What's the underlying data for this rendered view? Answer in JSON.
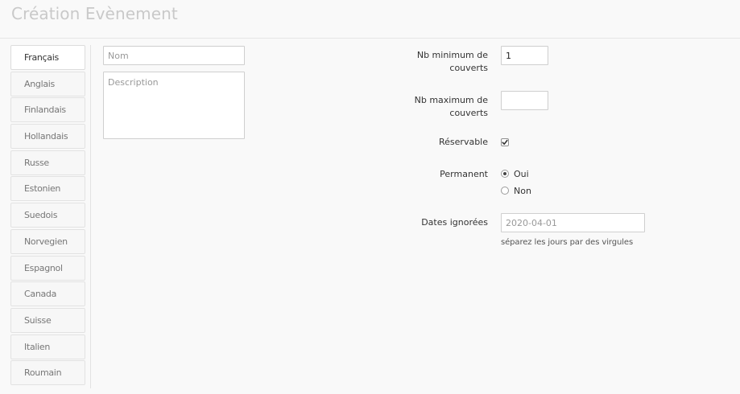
{
  "header": {
    "title": "Création Evènement"
  },
  "languages": {
    "tabs": [
      {
        "label": "Français",
        "active": true
      },
      {
        "label": "Anglais",
        "active": false
      },
      {
        "label": "Finlandais",
        "active": false
      },
      {
        "label": "Hollandais",
        "active": false
      },
      {
        "label": "Russe",
        "active": false
      },
      {
        "label": "Estonien",
        "active": false
      },
      {
        "label": "Suedois",
        "active": false
      },
      {
        "label": "Norvegien",
        "active": false
      },
      {
        "label": "Espagnol",
        "active": false
      },
      {
        "label": "Canada",
        "active": false
      },
      {
        "label": "Suisse",
        "active": false
      },
      {
        "label": "Italien",
        "active": false
      },
      {
        "label": "Roumain",
        "active": false
      }
    ]
  },
  "form": {
    "name": {
      "placeholder": "Nom",
      "value": ""
    },
    "description": {
      "placeholder": "Description",
      "value": ""
    },
    "min_covers": {
      "label": "Nb minimum de couverts",
      "label_lines": [
        "Nb minimum de",
        "couverts"
      ],
      "value": "1"
    },
    "max_covers": {
      "label": "Nb maximum de couverts",
      "label_lines": [
        "Nb maximum de",
        "couverts"
      ],
      "value": ""
    },
    "bookable": {
      "label": "Réservable",
      "checked": true
    },
    "permanent": {
      "label": "Permanent",
      "options": [
        {
          "label": "Oui",
          "selected": true
        },
        {
          "label": "Non",
          "selected": false
        }
      ]
    },
    "ignored_dates": {
      "label": "Dates ignorées",
      "placeholder": "2020-04-01",
      "value": "",
      "help": "séparez les jours par des virgules"
    }
  }
}
